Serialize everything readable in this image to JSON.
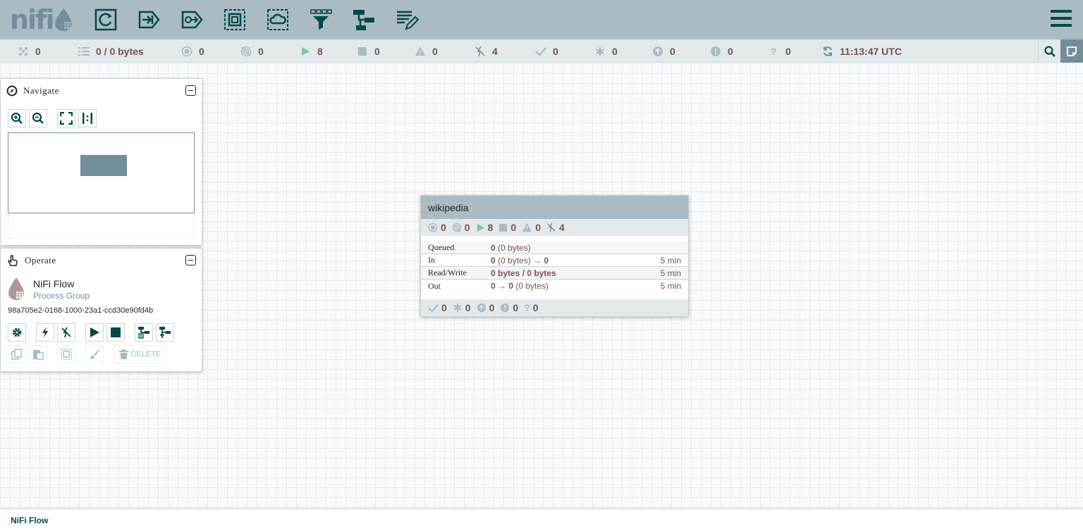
{
  "header": {
    "logo": "nifi",
    "toolbar": [
      {
        "name": "processor",
        "icon": "processor-icon"
      },
      {
        "name": "input-port",
        "icon": "input-port-icon"
      },
      {
        "name": "output-port",
        "icon": "output-port-icon"
      },
      {
        "name": "process-group",
        "icon": "process-group-icon"
      },
      {
        "name": "remote-process-group",
        "icon": "remote-process-group-icon"
      },
      {
        "name": "funnel",
        "icon": "funnel-icon"
      },
      {
        "name": "template",
        "icon": "template-icon"
      },
      {
        "name": "label",
        "icon": "label-icon"
      }
    ]
  },
  "status": {
    "active_threads": "0",
    "queued": "0 / 0 bytes",
    "transmitting": "0",
    "not_transmitting": "0",
    "running": "8",
    "stopped": "0",
    "invalid": "0",
    "disabled": "4",
    "up_to_date": "0",
    "locally_modified": "0",
    "stale": "0",
    "sync_failure": "0",
    "unknown": "?",
    "unknown_count": "0",
    "refreshed": "11:13:47 UTC"
  },
  "navigate": {
    "title": "Navigate"
  },
  "operate": {
    "title": "Operate",
    "component_name": "NiFi Flow",
    "component_type": "Process Group",
    "component_id": "98a705e2-0168-1000-23a1-ccd30e90fd4b",
    "delete_label": "DELETE"
  },
  "process_group": {
    "name": "wikipedia",
    "counts": {
      "transmitting": "0",
      "not_transmitting": "0",
      "running": "8",
      "stopped": "0",
      "invalid": "0",
      "disabled": "4"
    },
    "rows": {
      "queued_label": "Queued",
      "queued_count": "0",
      "queued_size": " (0 bytes)",
      "in_label": "In",
      "in_count": "0",
      "in_size": " (0 bytes) → ",
      "in_out": "0",
      "in_period": "5 min",
      "rw_label": "Read/Write",
      "rw_value": "0 bytes / 0 bytes",
      "rw_period": "5 min",
      "out_label": "Out",
      "out_count": "0 → 0",
      "out_size": " (0 bytes)",
      "out_period": "5 min"
    },
    "footer": {
      "up_to_date": "0",
      "locally_modified": "0",
      "stale": "0",
      "sync_failure": "0",
      "unknown": "?",
      "unknown_count": "0"
    }
  },
  "breadcrumb": {
    "current": "NiFi Flow"
  },
  "colors": {
    "header": "#aabbc3",
    "dark_teal": "#004849",
    "running_green": "#7dc7a0",
    "status_value": "#775351"
  }
}
